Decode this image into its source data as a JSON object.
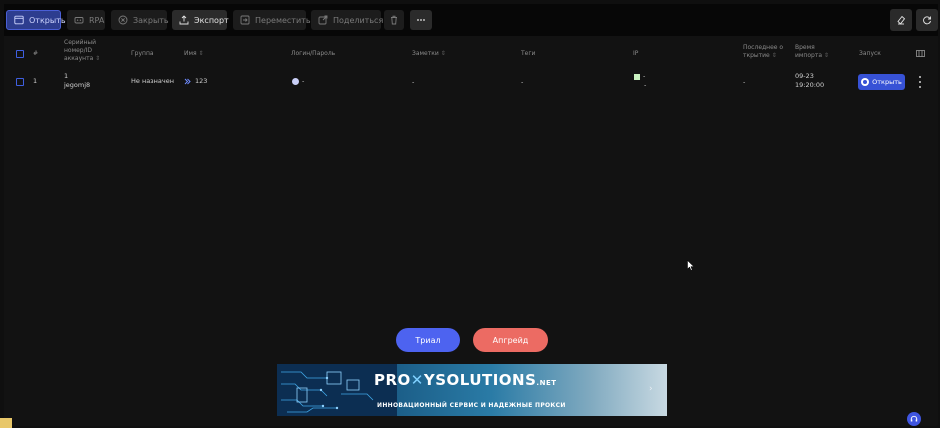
{
  "toolbar": {
    "open_label": "Открыть",
    "rpa_label": "RPA",
    "close_label": "Закрыть",
    "export_label": "Экспорт",
    "move_label": "Переместить",
    "share_label": "Поделиться"
  },
  "table": {
    "headers": {
      "num": "#",
      "serial_line1": "Серийный",
      "serial_line2": "номер/ID",
      "serial_line3": "аккаунта",
      "group": "Группа",
      "name": "Имя",
      "login": "Логин/Пароль",
      "notes": "Заметки",
      "tags": "Теги",
      "ip": "IP",
      "last_open_line1": "Последнее о",
      "last_open_line2": "ткрытие",
      "import_time_line1": "Время",
      "import_time_line2": "импорта",
      "launch": "Запуск"
    },
    "rows": [
      {
        "num": "1",
        "serial": "1",
        "account_id": "jegomj8",
        "group": "Не назначен",
        "name": "123",
        "login": "-",
        "notes": "-",
        "tags": "-",
        "ip_line1": "-",
        "ip_line2": "-",
        "last_open": "-",
        "import_date": "09-23",
        "import_time": "19:20:00",
        "open_label": "Открыть"
      }
    ]
  },
  "actions": {
    "trial_label": "Триал",
    "upgrade_label": "Апгрейд"
  },
  "banner": {
    "logo_pro": "PRO",
    "logo_ysolutions": "YSOLUTIONS",
    "logo_net": ".NET",
    "tagline": "ИННОВАЦИОННЫЙ СЕРВИС И НАДЕЖНЫЕ ПРОКСИ"
  },
  "colors": {
    "background": "#121212",
    "toolbar": "#070707",
    "primary": "#3752d6",
    "trial": "#4d63f0",
    "upgrade": "#ec6b63"
  }
}
